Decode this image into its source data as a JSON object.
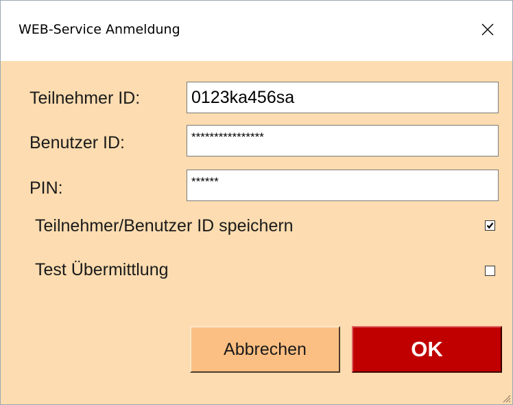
{
  "window": {
    "title": "WEB-Service Anmeldung",
    "close_glyph": "✕"
  },
  "form": {
    "participant_label": "Teilnehmer ID:",
    "participant_value": "0123ka456sa",
    "user_label": "Benutzer ID:",
    "user_value": "****************",
    "pin_label": "PIN:",
    "pin_value": "******",
    "save_ids_label": "Teilnehmer/Benutzer ID speichern",
    "save_ids_checked": true,
    "test_label": "Test Übermittlung",
    "test_checked": false
  },
  "buttons": {
    "cancel_label": "Abbrechen",
    "ok_label": "OK"
  },
  "colors": {
    "dialog_background": "#fcdcb0",
    "cancel_button": "#fcbf83",
    "ok_button": "#c00000",
    "ok_text": "#ffffff"
  }
}
